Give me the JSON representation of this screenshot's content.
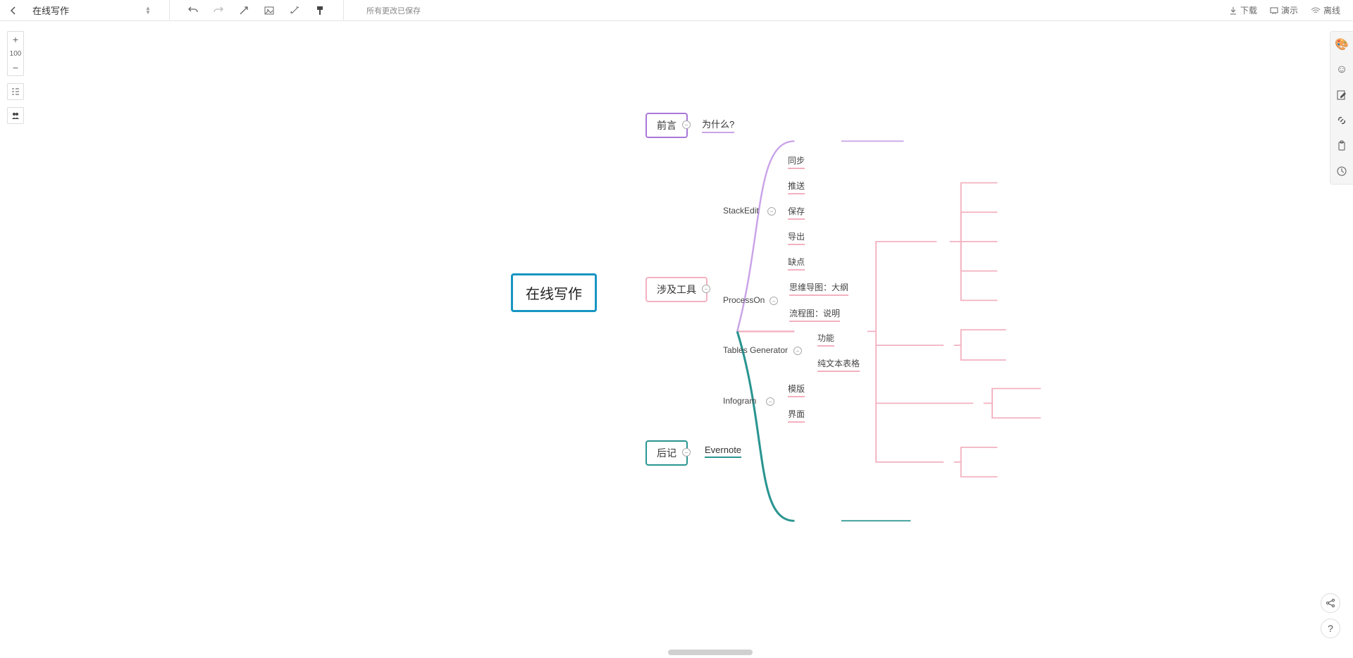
{
  "header": {
    "title": "在线写作",
    "status": "所有更改已保存",
    "download": "下载",
    "present": "演示",
    "offline": "离线"
  },
  "zoom": {
    "value": "100"
  },
  "mindmap": {
    "root": "在线写作",
    "b1": {
      "label": "前言",
      "children": [
        "为什么?"
      ]
    },
    "b2": {
      "label": "涉及工具",
      "tools": [
        {
          "name": "StackEdit",
          "children": [
            "同步",
            "推送",
            "保存",
            "导出",
            "缺点"
          ]
        },
        {
          "name": "ProcessOn",
          "children": [
            "思维导图：大纲",
            "流程图：说明"
          ]
        },
        {
          "name": "Tables Generator",
          "children": [
            "功能",
            "纯文本表格"
          ]
        },
        {
          "name": "Infogram",
          "children": [
            "模版",
            "界面"
          ]
        }
      ]
    },
    "b3": {
      "label": "后记",
      "children": [
        "Evernote"
      ]
    }
  },
  "colors": {
    "root": "#1795c2",
    "purple": "#a978d9",
    "pink": "#f3b1c0",
    "teal": "#2a9591"
  }
}
